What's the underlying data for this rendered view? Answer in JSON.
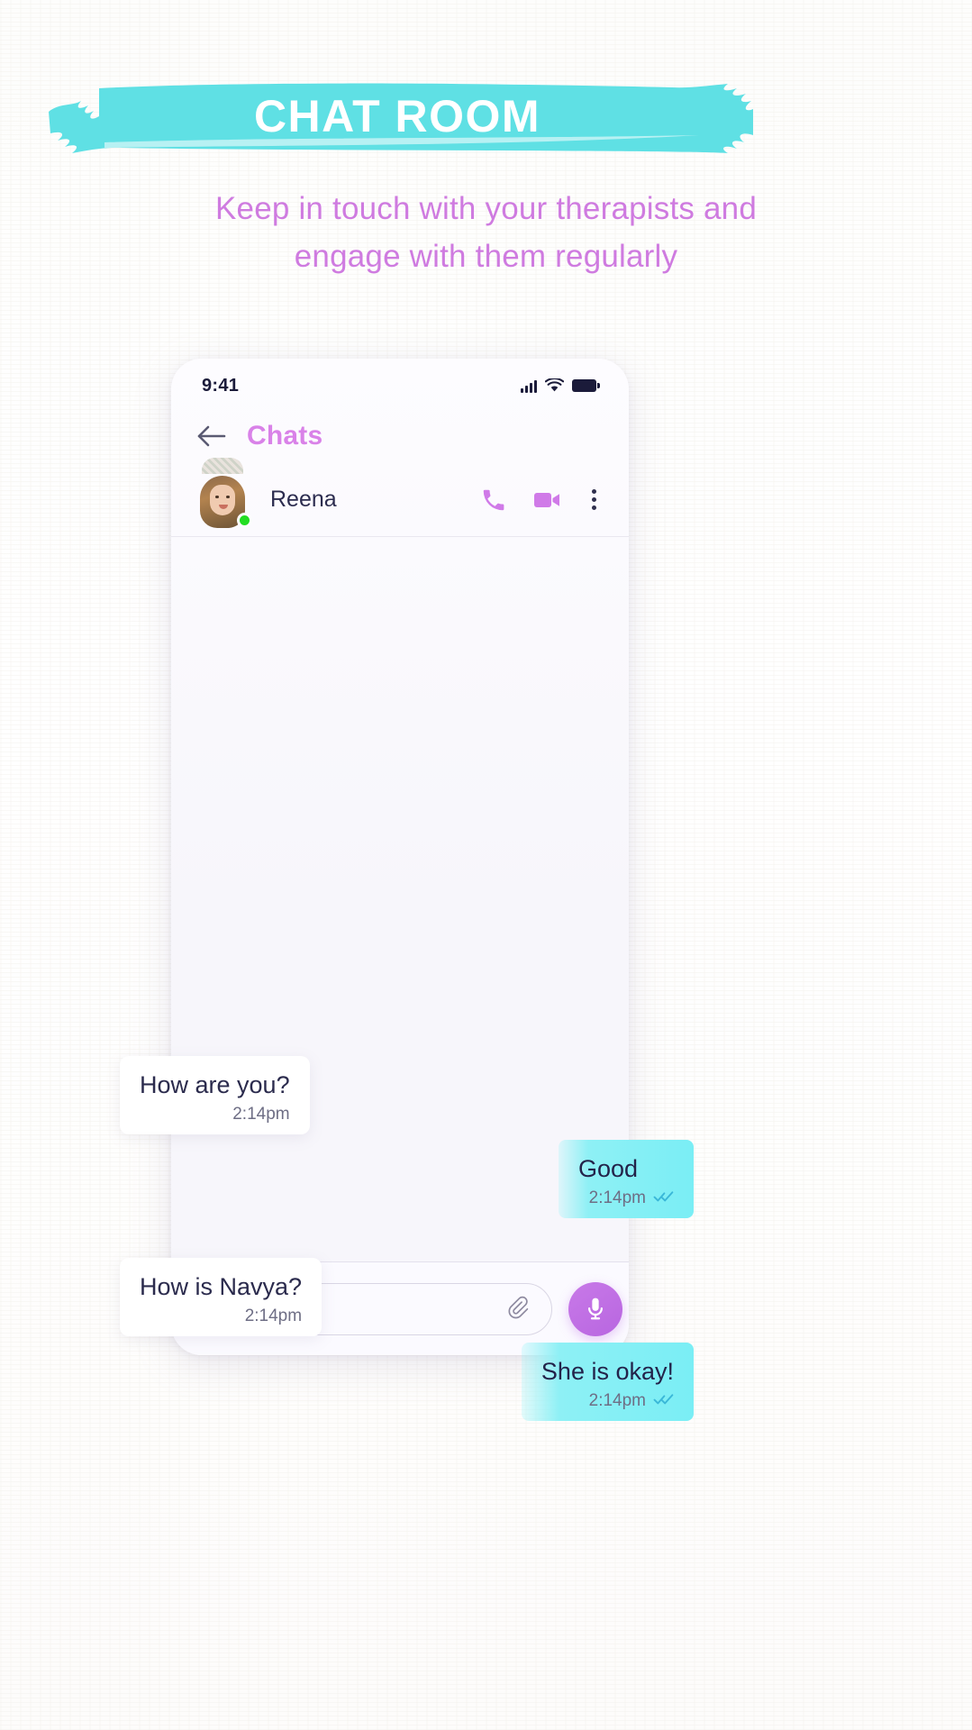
{
  "header": {
    "title": "CHAT ROOM",
    "banner_color": "#5fe0e4",
    "title_color": "#ffffff",
    "subtitle_line1": "Keep in touch with your therapists and",
    "subtitle_line2": "engage with them regularly",
    "subtitle_color": "#cf7be0"
  },
  "phone": {
    "status_bar": {
      "time": "9:41",
      "signal_icon": "cellular-signal-icon",
      "wifi_icon": "wifi-icon",
      "battery_icon": "battery-full-icon"
    },
    "nav": {
      "back_icon": "arrow-left-icon",
      "title": "Chats",
      "title_color": "#d982e8"
    },
    "contact": {
      "name": "Reena",
      "avatar_icon": "avatar-image",
      "online_status": "online",
      "online_color": "#22dd22",
      "call_icon": "phone-icon",
      "video_icon": "video-camera-icon",
      "more_icon": "more-vertical-icon",
      "action_color": "#d07ae8"
    },
    "messages": [
      {
        "id": 1,
        "direction": "incoming",
        "text": "How are you?",
        "time": "2:14pm",
        "status": ""
      },
      {
        "id": 2,
        "direction": "outgoing",
        "text": "Good",
        "time": "2:14pm",
        "status": "read"
      },
      {
        "id": 3,
        "direction": "incoming",
        "text": "How is Navya?",
        "time": "2:14pm",
        "status": ""
      },
      {
        "id": 4,
        "direction": "outgoing",
        "text": "She is okay!",
        "time": "2:14pm",
        "status": "read"
      }
    ],
    "composer": {
      "emoji_icon": "emoji-smiley-icon",
      "attach_icon": "paperclip-icon",
      "mic_icon": "microphone-icon",
      "input_value": "",
      "input_placeholder": "",
      "mic_color": "#c076e4"
    }
  }
}
